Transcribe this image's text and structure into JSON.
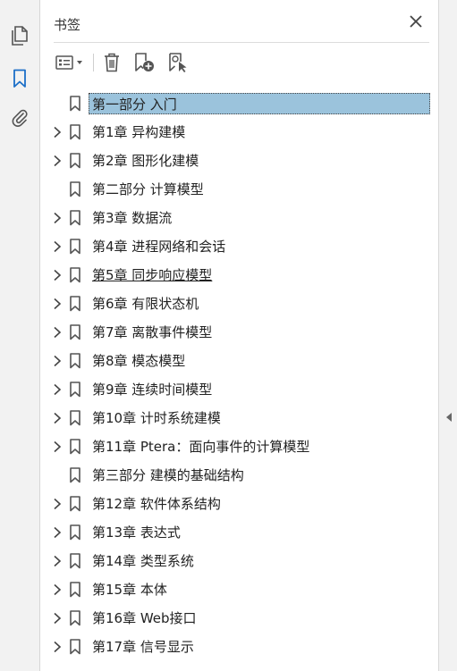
{
  "panel": {
    "title": "书签"
  },
  "sidebar": {
    "items": [
      {
        "name": "pages-icon"
      },
      {
        "name": "bookmarks-icon"
      },
      {
        "name": "attachments-icon"
      }
    ],
    "accent": "#1c6fc7"
  },
  "toolbar": {
    "buttons": [
      "options-menu-icon",
      "delete-bookmark-icon",
      "add-bookmark-icon",
      "bookmark-search-icon"
    ]
  },
  "bookmarks": [
    {
      "label": "第一部分 入门",
      "expandable": false,
      "selected": true
    },
    {
      "label": "第1章 异构建模",
      "expandable": true
    },
    {
      "label": "第2章 图形化建模",
      "expandable": true
    },
    {
      "label": "第二部分 计算模型",
      "expandable": false
    },
    {
      "label": "第3章 数据流",
      "expandable": true
    },
    {
      "label": "第4章 进程网络和会话",
      "expandable": true
    },
    {
      "label": "第5章 同步响应模型",
      "expandable": true,
      "underline": true
    },
    {
      "label": "第6章 有限状态机",
      "expandable": true
    },
    {
      "label": "第7章 离散事件模型",
      "expandable": true
    },
    {
      "label": "第8章 模态模型",
      "expandable": true
    },
    {
      "label": "第9章 连续时间模型",
      "expandable": true
    },
    {
      "label": "第10章 计时系统建模",
      "expandable": true
    },
    {
      "label": "第11章 Ptera：面向事件的计算模型",
      "expandable": true
    },
    {
      "label": "第三部分 建模的基础结构",
      "expandable": false
    },
    {
      "label": "第12章 软件体系结构",
      "expandable": true
    },
    {
      "label": "第13章 表达式",
      "expandable": true
    },
    {
      "label": "第14章 类型系统",
      "expandable": true
    },
    {
      "label": "第15章 本体",
      "expandable": true
    },
    {
      "label": "第16章 Web接口",
      "expandable": true
    },
    {
      "label": "第17章 信号显示",
      "expandable": true
    }
  ],
  "colors": {
    "selection": "#9bc3dc",
    "icon": "#555555"
  }
}
